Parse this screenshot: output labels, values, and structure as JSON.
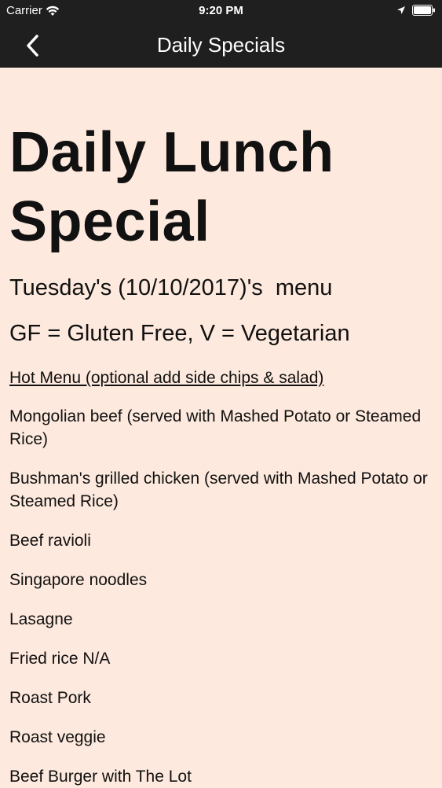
{
  "status_bar": {
    "carrier": "Carrier",
    "time": "9:20 PM"
  },
  "nav": {
    "back_icon": "chevron-left-icon",
    "title": "Daily Specials"
  },
  "page": {
    "title": "Daily Lunch Special",
    "day_line": "Tuesday's (10/10/2017)'s  menu",
    "legend": "GF = Gluten Free, V = Vegetarian",
    "section_heading": "Hot Menu (optional add side chips & salad)",
    "items": [
      "Mongolian beef (served with Mashed Potato or Steamed Rice)",
      "Bushman's grilled chicken (served with Mashed Potato or Steamed Rice)",
      "Beef ravioli",
      "Singapore noodles",
      "Lasagne",
      "Fried rice N/A",
      "Roast Pork",
      "Roast veggie",
      "Beef Burger with The Lot"
    ]
  },
  "colors": {
    "header_bg": "#1f1f1f",
    "page_bg": "#fde9dd",
    "text": "#111111"
  }
}
